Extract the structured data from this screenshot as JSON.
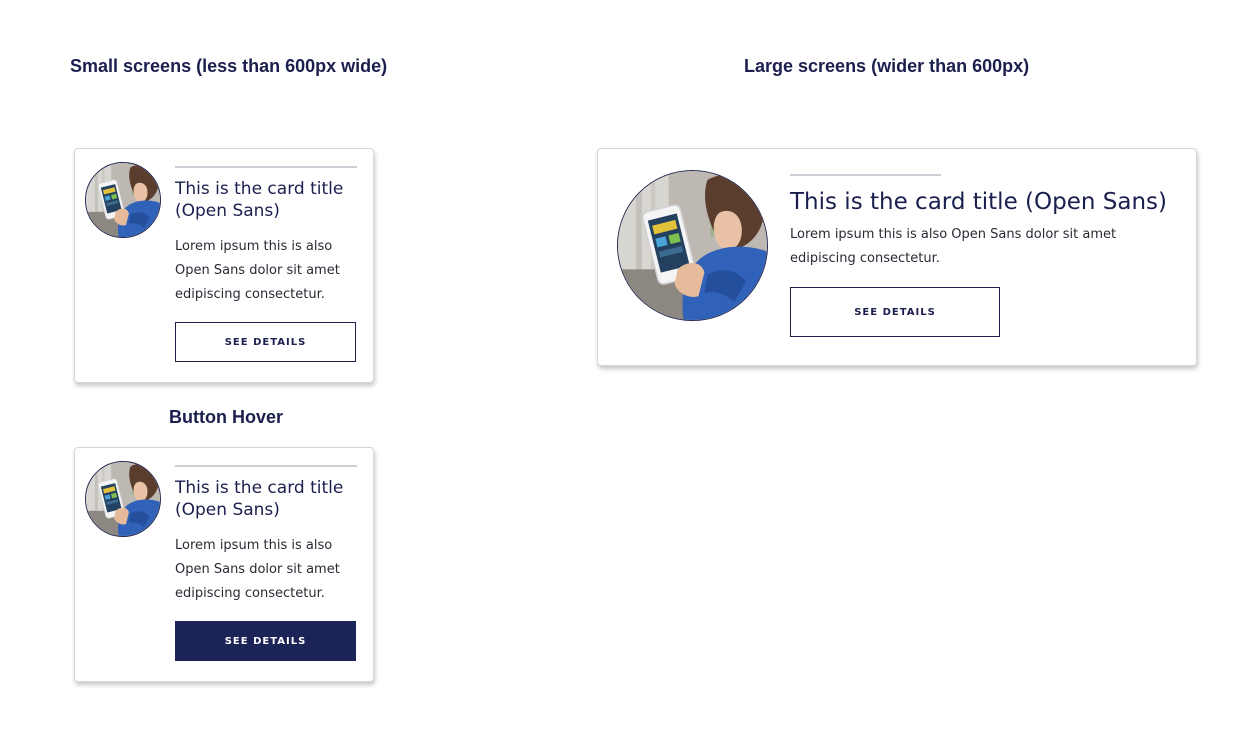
{
  "headings": {
    "small": "Small screens (less than 600px wide)",
    "large": "Large screens (wider than 600px)",
    "hover": "Button Hover"
  },
  "card": {
    "title": "This is the card title (Open Sans)",
    "body": "Lorem ipsum this is also Open Sans dolor sit amet edipiscing consectetur.",
    "button_label": "SEE DETAILS"
  },
  "image": {
    "subject": "woman-holding-smartphone-photo"
  },
  "colors": {
    "navy": "#1b1f4e",
    "button_hover_bg": "#1b2357",
    "card_border": "#d6d6dc",
    "divider": "#cdcfd6"
  }
}
